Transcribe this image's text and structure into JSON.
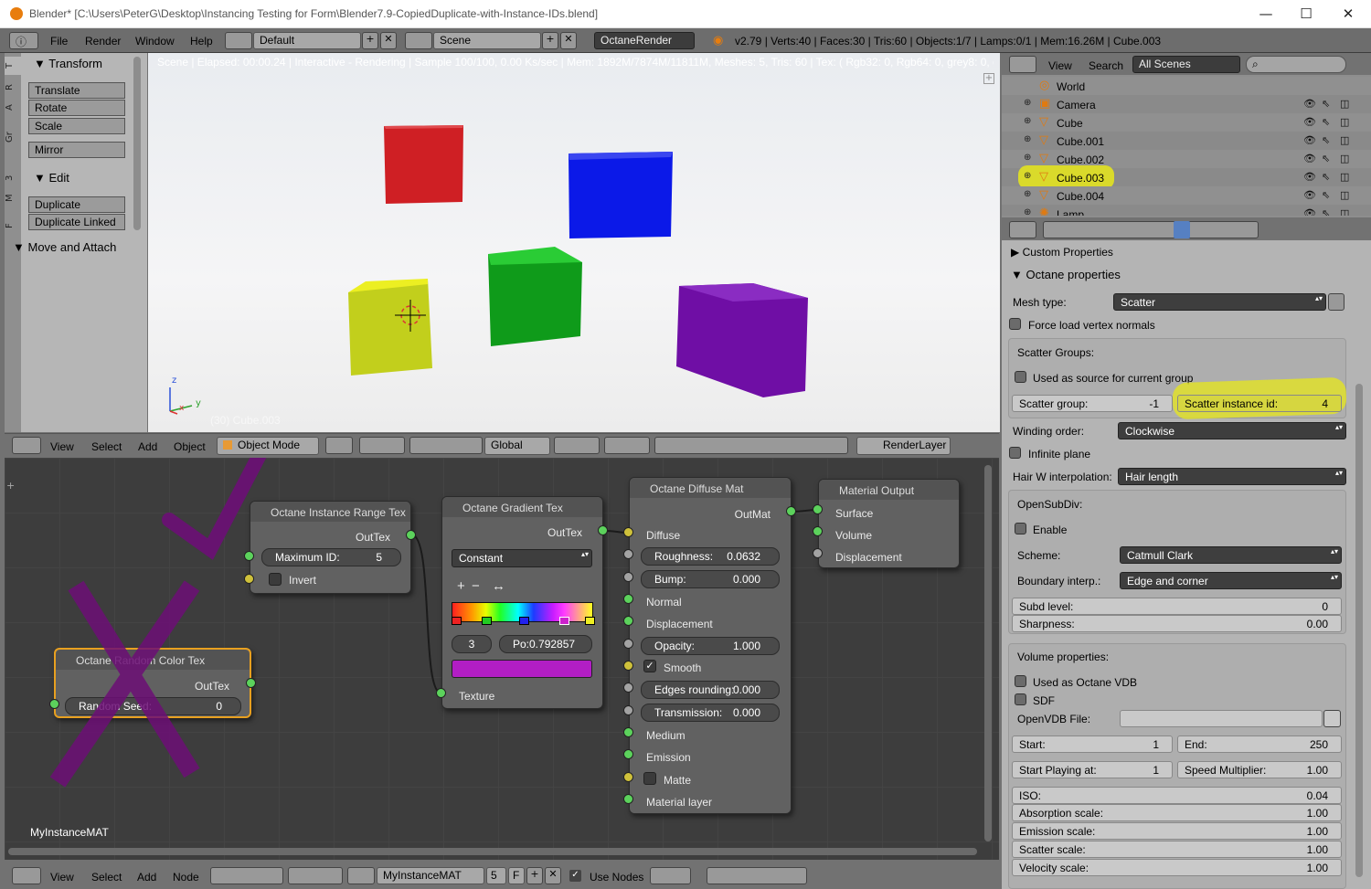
{
  "titlebar": {
    "title": "Blender* [C:\\Users\\PeterG\\Desktop\\Instancing Testing for Form\\Blender7.9-CopiedDuplicate-with-Instance-IDs.blend]",
    "minimize": "—",
    "maximize": "☐",
    "close": "✕"
  },
  "infobar": {
    "menus": [
      "File",
      "Render",
      "Window",
      "Help"
    ],
    "layout": "Default",
    "scene": "Scene",
    "engine": "OctaneRender",
    "stats": "v2.79 | Verts:40 | Faces:30 | Tris:60 | Objects:1/7 | Lamps:0/1 | Mem:16.26M | Cube.003"
  },
  "toolshelf": {
    "tabs": [
      "T",
      "R",
      "A",
      "Gr",
      "3",
      "M",
      "F"
    ],
    "transform_title": "Transform",
    "transform_buttons": [
      "Translate",
      "Rotate",
      "Scale"
    ],
    "mirror": "Mirror",
    "edit_title": "Edit",
    "edit_buttons": [
      "Duplicate",
      "Duplicate Linked"
    ],
    "move_attach": "Move and Attach"
  },
  "viewport": {
    "status": "Scene | Elapsed: 00:00.24 | Interactive - Rendering | Sample 100/100, 0.00 Ks/sec | Mem: 1892M/7874M/11811M, Meshes: 5, Tris: 60 | Tex: ( Rgb32: 0, Rgb64: 0, grey8: 0, grey16: 0 )",
    "object_label": "(30) Cube.003",
    "axis_z": "z",
    "axis_y": "y",
    "axis_x": "x"
  },
  "viewport_header": {
    "menus": [
      "View",
      "Select",
      "Add",
      "Object"
    ],
    "mode": "Object Mode",
    "orientation": "Global",
    "render_layer": "RenderLayer"
  },
  "nodes": {
    "range": {
      "title": "Octane Instance Range Tex",
      "out": "OutTex",
      "max_label": "Maximum ID:",
      "max_value": "5",
      "invert": "Invert"
    },
    "random": {
      "title": "Octane Random Color Tex",
      "out": "OutTex",
      "seed_label": "Random Seed:",
      "seed_value": "0"
    },
    "gradient": {
      "title": "Octane Gradient Tex",
      "out": "OutTex",
      "mode": "Constant",
      "plus": "+",
      "minus": "−",
      "flip": "↔",
      "stop_index": "3",
      "pos": "Po:0.792857",
      "in": "Texture",
      "ramp_color": "#b21ec4"
    },
    "diffuse": {
      "title": "Octane Diffuse Mat",
      "out": "OutMat",
      "diffuse": "Diffuse",
      "roughness_label": "Roughness:",
      "roughness": "0.0632",
      "bump_label": "Bump:",
      "bump": "0.000",
      "normal": "Normal",
      "displacement": "Displacement",
      "opacity_label": "Opacity:",
      "opacity": "1.000",
      "smooth": "Smooth",
      "edges_label": "Edges rounding:",
      "edges": "0.000",
      "trans_label": "Transmission:",
      "trans": "0.000",
      "medium": "Medium",
      "emission": "Emission",
      "matte": "Matte",
      "material_layer": "Material layer"
    },
    "output": {
      "title": "Material Output",
      "surface": "Surface",
      "volume": "Volume",
      "displacement": "Displacement"
    },
    "tree_name": "MyInstanceMAT"
  },
  "node_header": {
    "menus": [
      "View",
      "Select",
      "Add",
      "Node"
    ],
    "material": "MyInstanceMAT",
    "users": "5",
    "fake": "F",
    "use_nodes": "Use Nodes"
  },
  "outliner": {
    "view": "View",
    "search": "Search",
    "filter": "All Scenes",
    "items": [
      {
        "name": "World",
        "selected": false
      },
      {
        "name": "Camera",
        "selected": false
      },
      {
        "name": "Cube",
        "selected": false
      },
      {
        "name": "Cube.001",
        "selected": false
      },
      {
        "name": "Cube.002",
        "selected": false
      },
      {
        "name": "Cube.003",
        "selected": true
      },
      {
        "name": "Cube.004",
        "selected": false
      },
      {
        "name": "Lamp",
        "selected": false
      }
    ]
  },
  "props": {
    "custom": "Custom Properties",
    "octane": "Octane properties",
    "mesh_type_label": "Mesh type:",
    "mesh_type": "Scatter",
    "force_load": "Force load vertex normals",
    "scatter_groups": "Scatter Groups:",
    "used_as_source": "Used as source for current group",
    "scatter_group_label": "Scatter group:",
    "scatter_group": "-1",
    "scatter_id_label": "Scatter instance id:",
    "scatter_id": "4",
    "winding_label": "Winding order:",
    "winding": "Clockwise",
    "infinite_plane": "Infinite plane",
    "hair_label": "Hair W interpolation:",
    "hair": "Hair length",
    "opensubdiv": "OpenSubDiv:",
    "enable": "Enable",
    "scheme_label": "Scheme:",
    "scheme": "Catmull Clark",
    "boundary_label": "Boundary interp.:",
    "boundary": "Edge and corner",
    "subd_label": "Subd level:",
    "subd": "0",
    "sharp_label": "Sharpness:",
    "sharp": "0.00",
    "volume": "Volume properties:",
    "used_vdb": "Used as Octane VDB",
    "sdf": "SDF",
    "vdb_file": "OpenVDB File:",
    "start_label": "Start:",
    "start": "1",
    "end_label": "End:",
    "end": "250",
    "playing_label": "Start Playing at:",
    "playing": "1",
    "speed_label": "Speed Multiplier:",
    "speed": "1.00",
    "iso_label": "ISO:",
    "iso": "0.04",
    "absorption_label": "Absorption scale:",
    "absorption": "1.00",
    "emission_label": "Emission scale:",
    "emission": "1.00",
    "scatter_label": "Scatter scale:",
    "scatter": "1.00",
    "velocity_label": "Velocity scale:",
    "velocity": "1.00"
  },
  "colors": {
    "highlight": "#e7e71a",
    "annotation": "#7e0a86",
    "cube_red": "#d01f24",
    "cube_blue": "#0b18e8",
    "cube_green": "#16a51e",
    "cube_yellow": "#c9d31a",
    "cube_purple": "#6e0ea3"
  }
}
